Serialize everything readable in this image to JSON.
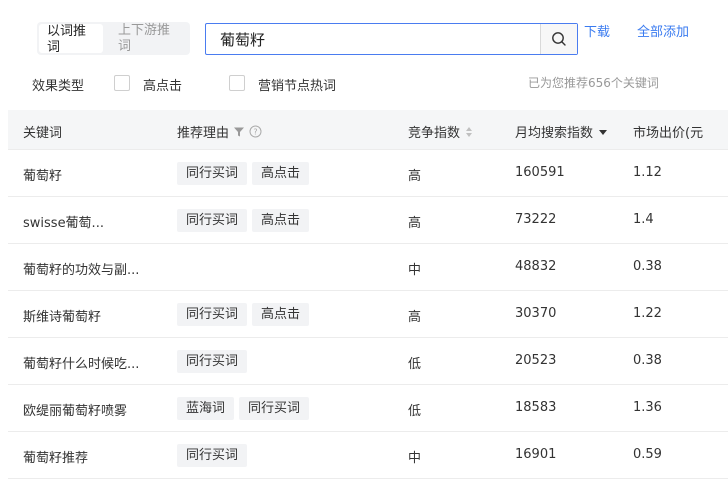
{
  "tabs": [
    {
      "label": "以词推词",
      "active": true
    },
    {
      "label": "上下游推词",
      "active": false
    }
  ],
  "search": {
    "value": "葡萄籽",
    "button_icon": "search-icon"
  },
  "links": {
    "download": "下载",
    "add_all": "全部添加"
  },
  "filters": {
    "label": "效果类型",
    "options": [
      {
        "label": "高点击",
        "checked": false
      },
      {
        "label": "营销节点热词",
        "checked": false
      }
    ]
  },
  "recommend_text": "已为您推荐656个关键词",
  "table": {
    "headers": {
      "keyword": "关键词",
      "reason": "推荐理由",
      "competition": "竞争指数",
      "monthly_search": "月均搜索指数",
      "price": "市场出价(元"
    },
    "header_icons": [
      "filter-icon",
      "help-icon",
      "sort-icon",
      "sort-desc-icon"
    ],
    "rows": [
      {
        "keyword": "葡萄籽",
        "tags": [
          "同行买词",
          "高点击"
        ],
        "competition": "高",
        "search": "160591",
        "price": "1.12"
      },
      {
        "keyword": "swisse葡萄...",
        "tags": [
          "同行买词",
          "高点击"
        ],
        "competition": "高",
        "search": "73222",
        "price": "1.4"
      },
      {
        "keyword": "葡萄籽的功效与副...",
        "tags": [],
        "competition": "中",
        "search": "48832",
        "price": "0.38"
      },
      {
        "keyword": "斯维诗葡萄籽",
        "tags": [
          "同行买词",
          "高点击"
        ],
        "competition": "高",
        "search": "30370",
        "price": "1.22"
      },
      {
        "keyword": "葡萄籽什么时候吃...",
        "tags": [
          "同行买词"
        ],
        "competition": "低",
        "search": "20523",
        "price": "0.38"
      },
      {
        "keyword": "欧缇丽葡萄籽喷雾",
        "tags": [
          "蓝海词",
          "同行买词"
        ],
        "competition": "低",
        "search": "18583",
        "price": "1.36"
      },
      {
        "keyword": "葡萄籽推荐",
        "tags": [
          "同行买词"
        ],
        "competition": "中",
        "search": "16901",
        "price": "0.59"
      }
    ]
  },
  "colors": {
    "accent": "#3a7bf0",
    "border_focus": "#4a7cf0",
    "muted": "#999999",
    "tag_bg": "#f2f3f5"
  }
}
